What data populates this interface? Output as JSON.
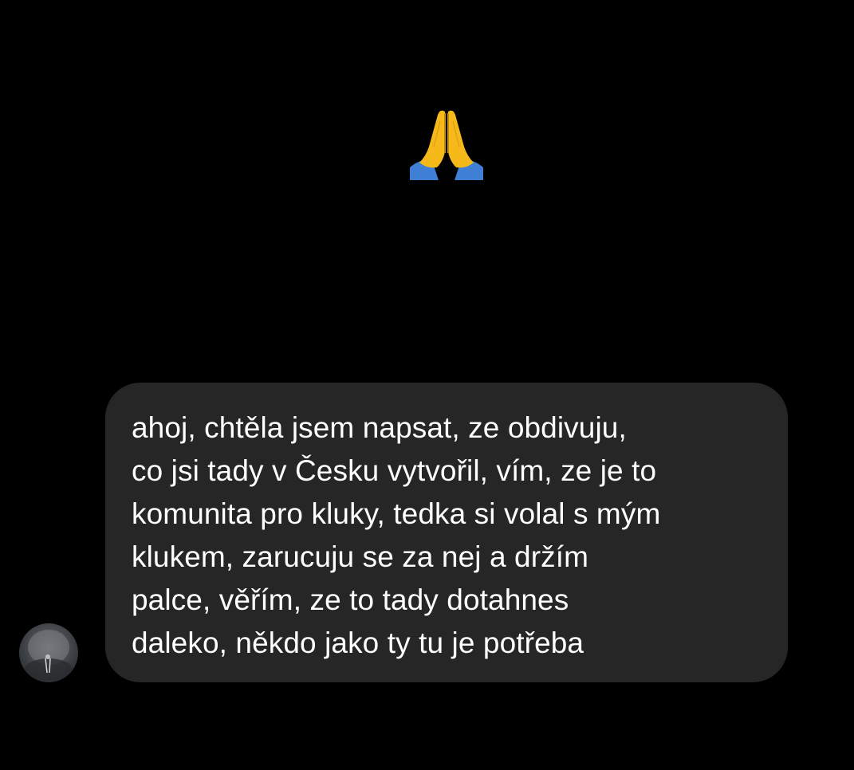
{
  "conversation": {
    "emoji_message": {
      "icon": "folded-hands-icon",
      "glyph": "🙏"
    },
    "incoming_message": {
      "avatar_icon": "avatar-photo",
      "text": "ahoj, chtěla jsem napsat, ze obdivuju,\nco jsi tady v Česku vytvořil, vím, ze je to\nkomunita pro kluky, tedka si volal s mým\nklukem, zarucuju se za nej a držím\npalce, věřím, ze to tady dotahnes\ndaleko, někdo jako ty tu je potřeba"
    }
  },
  "colors": {
    "background": "#000000",
    "bubble": "#262626",
    "text": "#ffffff"
  }
}
